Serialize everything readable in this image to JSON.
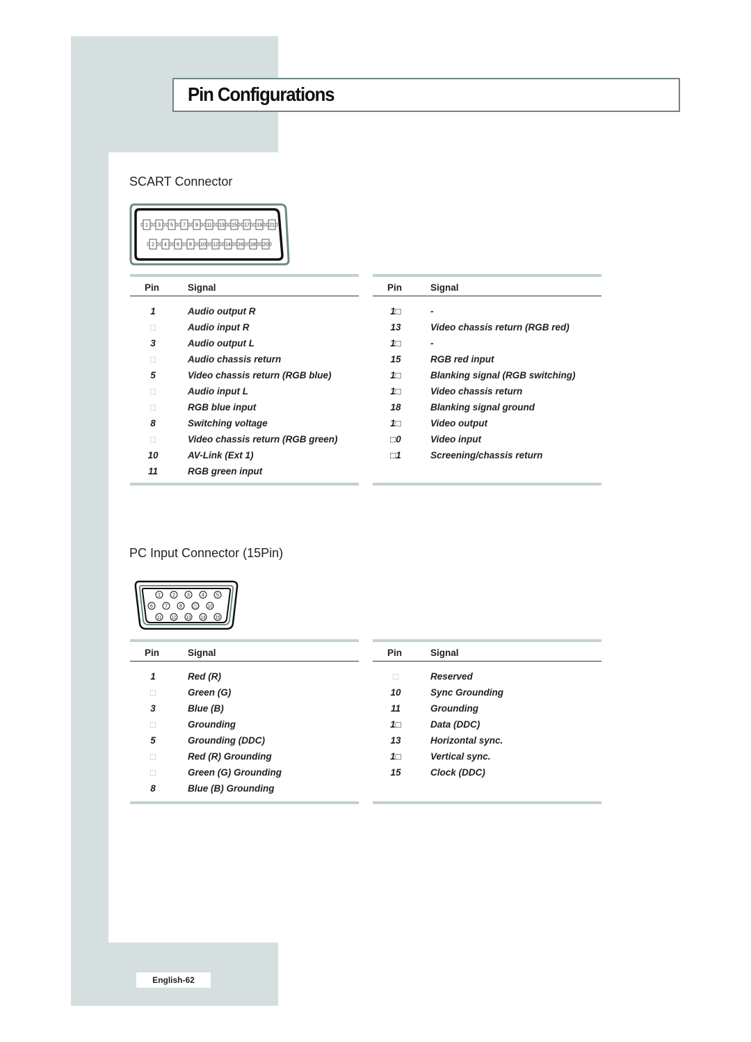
{
  "page": {
    "title": "Pin Configurations",
    "page_number": "English-62"
  },
  "colors": {
    "background_band": "#d5dfe0",
    "table_bar": "#c2d0d1",
    "title_border": "#6e8484"
  },
  "scart": {
    "heading": "SCART Connector",
    "connector_icon": "scart-connector-icon",
    "connector_pins_top": [
      "1",
      "3",
      "5",
      "7",
      "9",
      "11",
      "13",
      "15",
      "17",
      "19",
      "21"
    ],
    "connector_pins_bottom": [
      "2",
      "4",
      "6",
      "8",
      "10",
      "12",
      "14",
      "16",
      "18",
      "20"
    ],
    "left_table": {
      "header_pin": "Pin",
      "header_signal": "Signal",
      "rows": [
        {
          "pin": "1",
          "signal": "Audio output R"
        },
        {
          "pin": "□",
          "signal": "Audio input R"
        },
        {
          "pin": "3",
          "signal": "Audio output L"
        },
        {
          "pin": "□",
          "signal": "Audio chassis return"
        },
        {
          "pin": "5",
          "signal": "Video chassis return (RGB blue)"
        },
        {
          "pin": "□",
          "signal": "Audio input L"
        },
        {
          "pin": "□",
          "signal": "RGB blue input"
        },
        {
          "pin": "8",
          "signal": "Switching voltage"
        },
        {
          "pin": "□",
          "signal": "Video chassis return (RGB green)"
        },
        {
          "pin": "10",
          "signal": "AV-Link (Ext 1)"
        },
        {
          "pin": "11",
          "signal": "RGB green input"
        }
      ]
    },
    "right_table": {
      "header_pin": "Pin",
      "header_signal": "Signal",
      "rows": [
        {
          "pin": "1□",
          "signal": "-"
        },
        {
          "pin": "13",
          "signal": "Video chassis return (RGB red)"
        },
        {
          "pin": "1□",
          "signal": "-"
        },
        {
          "pin": "15",
          "signal": "RGB red input"
        },
        {
          "pin": "1□",
          "signal": "Blanking signal (RGB switching)"
        },
        {
          "pin": "1□",
          "signal": "Video chassis return"
        },
        {
          "pin": "18",
          "signal": "Blanking signal ground"
        },
        {
          "pin": "1□",
          "signal": "Video output"
        },
        {
          "pin": "□0",
          "signal": "Video input"
        },
        {
          "pin": "□1",
          "signal": "Screening/chassis return"
        }
      ]
    }
  },
  "pc": {
    "heading": "PC Input Connector (15Pin)",
    "connector_icon": "dsub-15pin-connector-icon",
    "connector_pins_row1": [
      "1",
      "2",
      "3",
      "4",
      "5"
    ],
    "connector_pins_row2": [
      "6",
      "7",
      "8",
      "",
      "10"
    ],
    "connector_pins_row3": [
      "11",
      "12",
      "13",
      "14",
      "15"
    ],
    "left_table": {
      "header_pin": "Pin",
      "header_signal": "Signal",
      "rows": [
        {
          "pin": "1",
          "signal": "Red (R)"
        },
        {
          "pin": "□",
          "signal": "Green (G)"
        },
        {
          "pin": "3",
          "signal": "Blue (B)"
        },
        {
          "pin": "□",
          "signal": "Grounding"
        },
        {
          "pin": "5",
          "signal": "Grounding (DDC)"
        },
        {
          "pin": "□",
          "signal": "Red (R) Grounding"
        },
        {
          "pin": "□",
          "signal": "Green (G) Grounding"
        },
        {
          "pin": "8",
          "signal": "Blue (B) Grounding"
        }
      ]
    },
    "right_table": {
      "header_pin": "Pin",
      "header_signal": "Signal",
      "rows": [
        {
          "pin": "□",
          "signal": "Reserved"
        },
        {
          "pin": "10",
          "signal": "Sync Grounding"
        },
        {
          "pin": "11",
          "signal": "Grounding"
        },
        {
          "pin": "1□",
          "signal": "Data (DDC)"
        },
        {
          "pin": "13",
          "signal": "Horizontal sync."
        },
        {
          "pin": "1□",
          "signal": "Vertical sync."
        },
        {
          "pin": "15",
          "signal": "Clock (DDC)"
        }
      ]
    }
  }
}
